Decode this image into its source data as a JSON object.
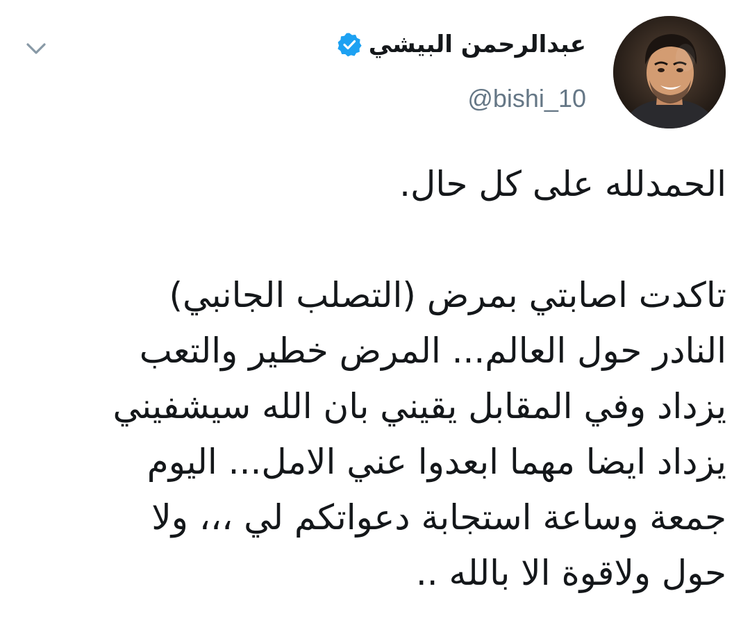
{
  "author": {
    "display_name": "عبدالرحمن البيشي",
    "handle": "@bishi_10",
    "verified": true,
    "verified_color": "#1da1f2"
  },
  "tweet": {
    "paragraph1": [
      "الحمدلله على كل حال."
    ],
    "paragraph2": [
      "تاكدت اصابتي بمرض (التصلب الجانبي)",
      "النادر حول العالم... المرض خطير والتعب",
      "يزداد وفي المقابل يقيني بان الله سيشفيني",
      "يزداد ايضا مهما ابعدوا عني الامل... اليوم",
      "جمعة وساعة استجابة دعواتكم لي ،،، ولا",
      "حول ولاقوة الا بالله .."
    ]
  },
  "icons": {
    "menu": "chevron-down-icon",
    "badge": "verified-badge-icon"
  },
  "colors": {
    "text": "#14171a",
    "secondary_text": "#657786",
    "chevron": "#8899a6",
    "background": "#ffffff"
  }
}
